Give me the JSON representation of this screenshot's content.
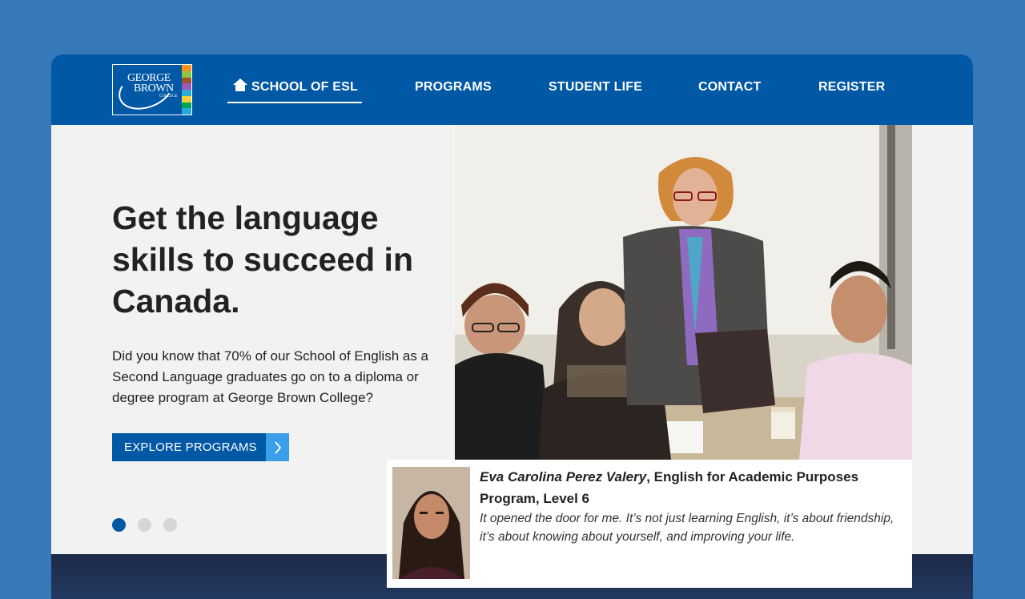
{
  "colors": {
    "page_background": "#3579b8",
    "nav_background": "#0158a5",
    "cta_background": "#0158a5",
    "cta_arrow": "#3a9ee8",
    "logo_color_bar": [
      "#f7941d",
      "#8cc63f",
      "#a0522d",
      "#9b59b6",
      "#2eaadc",
      "#f4d03f",
      "#00a651",
      "#27a9e1"
    ]
  },
  "logo": {
    "line1": "GEORGE",
    "line2": "BROWN",
    "line3": "COLLEGE"
  },
  "nav": {
    "items": [
      {
        "label": "SCHOOL OF ESL",
        "icon": "home-icon",
        "active": true
      },
      {
        "label": "PROGRAMS"
      },
      {
        "label": "STUDENT LIFE"
      },
      {
        "label": "CONTACT"
      },
      {
        "label": "REGISTER"
      }
    ]
  },
  "hero": {
    "title": "Get the language skills to succeed in Canada.",
    "body": "Did you know that 70% of our School of English as a Second Language graduates go on to a diploma or degree program at George Brown College?",
    "cta_label": "EXPLORE PROGRAMS",
    "cta_icon": "chevron-right-icon"
  },
  "carousel": {
    "slide_count": 3,
    "active_index": 0
  },
  "testimonial": {
    "name": "Eva Carolina Perez Valery",
    "program": ", English for Academic Purposes Program, Level 6",
    "quote": "It opened the door for me. It’s not just learning English, it’s about friendship, it’s about knowing about yourself, and improving your life."
  }
}
